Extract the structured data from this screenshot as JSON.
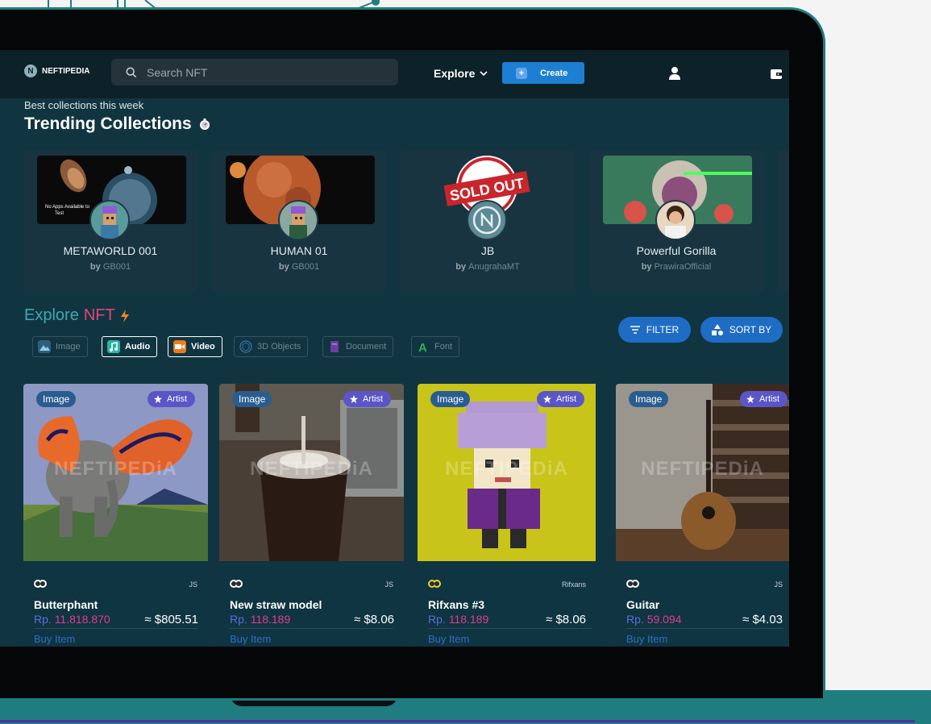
{
  "nav": {
    "logo": "NEFTIPEDIA",
    "logo_mark": "N",
    "search_placeholder": "Search NFT",
    "explore_label": "Explore",
    "create_label": "Create",
    "icons": {
      "search": "search-icon",
      "user": "user-icon",
      "wallet": "wallet-icon",
      "chevron": "chevron-down-icon"
    }
  },
  "trending": {
    "subtitle": "Best collections this week",
    "title": "Trending Collections",
    "by_label": "by",
    "items": [
      {
        "name": "METAWORLD 001",
        "creator": "GB001",
        "banner_text": "No Apps Available to Test"
      },
      {
        "name": "HUMAN 01",
        "creator": "GB001",
        "banner_text": ""
      },
      {
        "name": "JB",
        "creator": "AnugrahaMT",
        "banner_text": "SOLD OUT"
      },
      {
        "name": "Powerful Gorilla",
        "creator": "PrawiraOfficial",
        "banner_text": ""
      }
    ]
  },
  "explore": {
    "title_word": "Explore",
    "title_accent": "NFT",
    "filter_label": "FILTER",
    "sort_label": "SORT BY",
    "categories": [
      {
        "label": "Image",
        "active": false
      },
      {
        "label": "Audio",
        "active": true
      },
      {
        "label": "Video",
        "active": true
      },
      {
        "label": "3D Objects",
        "active": false
      },
      {
        "label": "Document",
        "active": false
      },
      {
        "label": "Font",
        "active": false
      }
    ]
  },
  "watermark": "NEFTIPEDiA",
  "cards": [
    {
      "type": "Image",
      "role": "Artist",
      "owner": "JS",
      "title": "Butterphant",
      "price_prefix": "Rp.",
      "price": "11.818.870",
      "usd": "≈ $805.51",
      "buy": "Buy Item"
    },
    {
      "type": "Image",
      "role": "Artist",
      "owner": "JS",
      "title": "New straw model",
      "price_prefix": "Rp.",
      "price": "118.189",
      "usd": "≈ $8.06",
      "buy": "Buy Item"
    },
    {
      "type": "Image",
      "role": "Artist",
      "owner": "Rifxans",
      "title": "Rifxans #3",
      "price_prefix": "Rp.",
      "price": "118.189",
      "usd": "≈ $8.06",
      "buy": "Buy Item"
    },
    {
      "type": "Image",
      "role": "Artist",
      "owner": "JS",
      "title": "Guitar",
      "price_prefix": "Rp.",
      "price": "59.094",
      "usd": "≈ $4.03",
      "buy": "Buy Item"
    }
  ]
}
